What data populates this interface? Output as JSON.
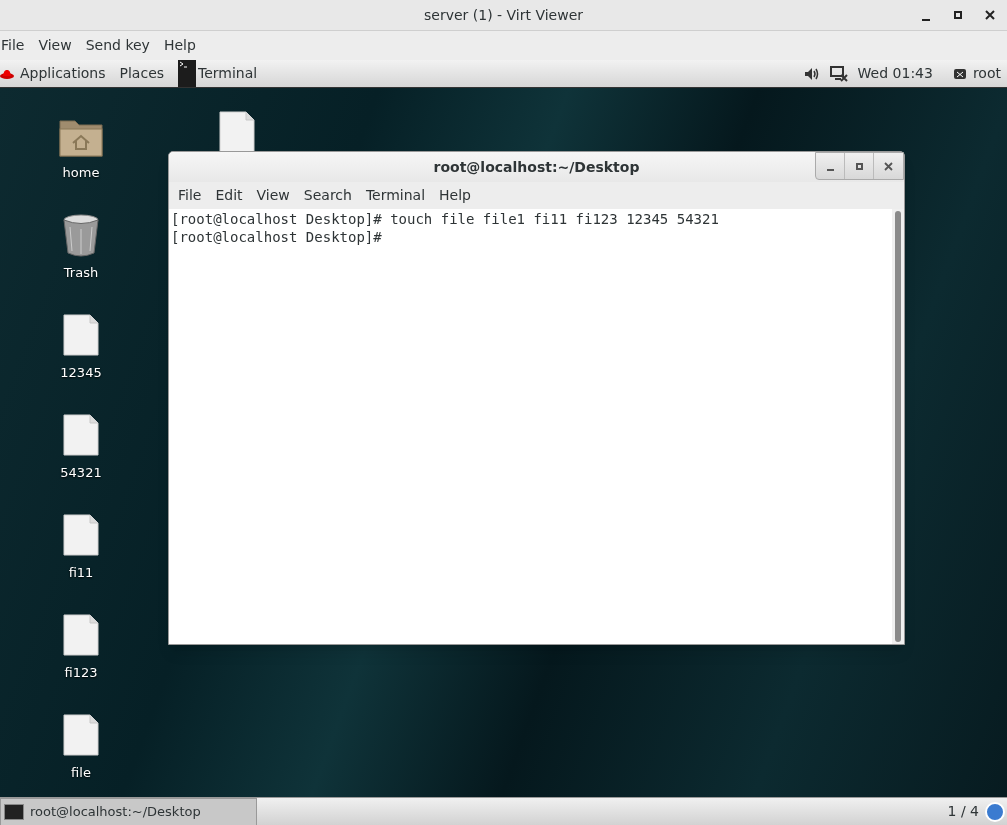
{
  "window": {
    "title": "server (1) - Virt Viewer"
  },
  "menu": [
    "File",
    "View",
    "Send key",
    "Help"
  ],
  "top_panel": {
    "applications": "Applications",
    "places": "Places",
    "app": "Terminal",
    "clock": "Wed 01:43",
    "user": "root"
  },
  "desktop": {
    "icons": [
      {
        "label": "home",
        "kind": "folder"
      },
      {
        "label": "Trash",
        "kind": "trash"
      },
      {
        "label": "12345",
        "kind": "file"
      },
      {
        "label": "54321",
        "kind": "file"
      },
      {
        "label": "fi11",
        "kind": "file"
      },
      {
        "label": "fi123",
        "kind": "file"
      },
      {
        "label": "file",
        "kind": "file"
      }
    ],
    "hidden_icon": {
      "kind": "file"
    }
  },
  "terminal": {
    "title": "root@localhost:~/Desktop",
    "menu": [
      "File",
      "Edit",
      "View",
      "Search",
      "Terminal",
      "Help"
    ],
    "lines": [
      "[root@localhost Desktop]# touch file file1 fi11 fi123 12345 54321",
      "[root@localhost Desktop]#"
    ]
  },
  "taskbar": {
    "tasks": [
      {
        "label": "root@localhost:~/Desktop",
        "selected": true
      }
    ],
    "workspace": "1 / 4"
  }
}
